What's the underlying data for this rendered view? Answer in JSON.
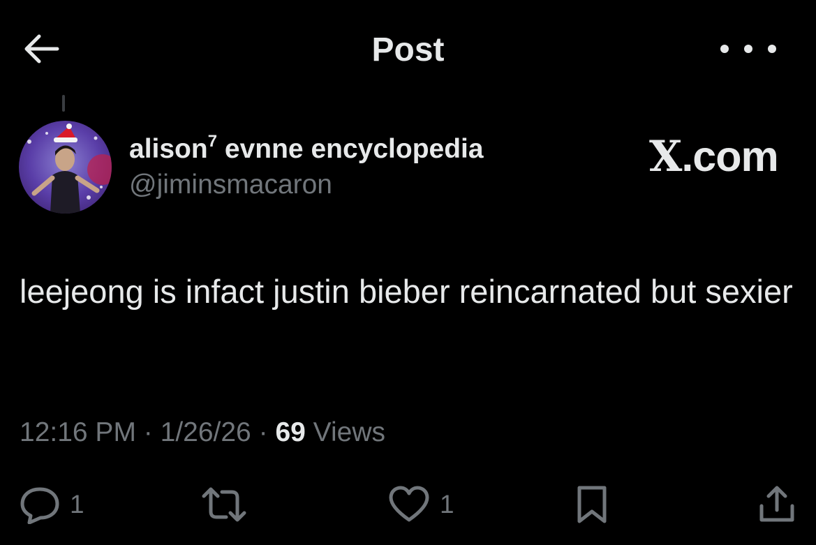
{
  "header": {
    "title": "Post",
    "back_icon": "arrow-left-icon",
    "more_icon": "more-horizontal-icon"
  },
  "post": {
    "author": {
      "name": "alison",
      "name_superscript": "7",
      "name_suffix": " evnne encyclopedia",
      "handle": "@jiminsmacaron"
    },
    "watermark": {
      "logo": "X",
      "text": ".com"
    },
    "text": "leejeong is infact justin bieber reincarnated but sexier",
    "time": "12:16 PM",
    "date": "1/26/26",
    "views_count": "69",
    "views_label": "Views",
    "separator": "·"
  },
  "actions": {
    "reply_count": "1",
    "like_count": "1"
  },
  "colors": {
    "background": "#000000",
    "text": "#e7e9ea",
    "muted": "#71767b"
  }
}
